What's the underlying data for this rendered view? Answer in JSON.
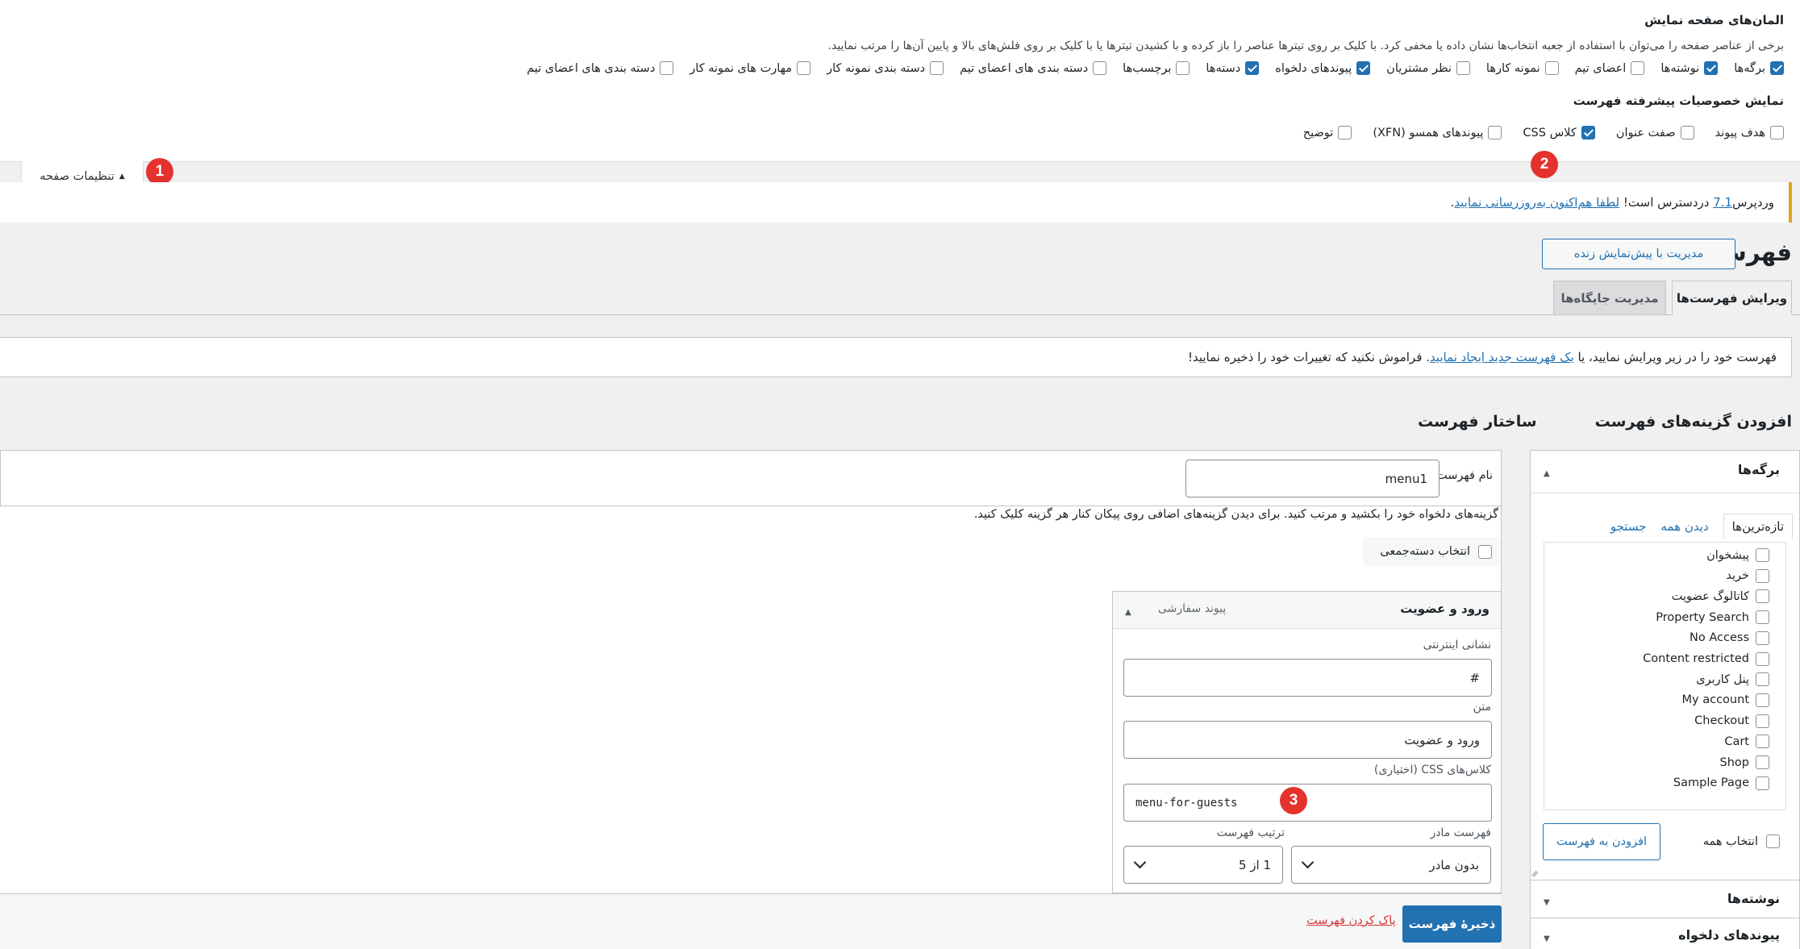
{
  "screen_options": {
    "boxes_heading": "المان‌های صفحه نمایش",
    "boxes_desc": "برخی از عناصر صفحه را می‌توان با استفاده از جعبه انتخاب‌ها نشان داده یا مخفی کرد. با کلیک بر روی تیترها عناصر را باز کرده و با کشیدن تیترها یا با کلیک بر روی فلش‌های بالا و پایین آن‌ها را مرتب نمایید.",
    "boxes": [
      {
        "label": "برگه‌ها",
        "checked": true
      },
      {
        "label": "نوشته‌ها",
        "checked": true
      },
      {
        "label": "اعضای تیم",
        "checked": false
      },
      {
        "label": "نمونه کارها",
        "checked": false
      },
      {
        "label": "نظر مشتریان",
        "checked": false
      },
      {
        "label": "پیوندهای دلخواه",
        "checked": true
      },
      {
        "label": "دسته‌ها",
        "checked": true
      },
      {
        "label": "برچسب‌ها",
        "checked": false
      },
      {
        "label": "دسته بندی های اعضای تیم",
        "checked": false
      },
      {
        "label": "دسته بندی نمونه کار",
        "checked": false
      },
      {
        "label": "مهارت های نمونه کار",
        "checked": false
      },
      {
        "label": "دسته بندی های اعضای تیم",
        "checked": false
      }
    ],
    "advanced_heading": "نمایش خصوصیات پیشرفته فهرست",
    "advanced": [
      {
        "label": "هدف پیوند",
        "checked": false
      },
      {
        "label": "صفت عنوان",
        "checked": false
      },
      {
        "label": "کلاس CSS",
        "checked": true
      },
      {
        "label": "پیوندهای همسو (XFN)",
        "checked": false
      },
      {
        "label": "توضیح",
        "checked": false
      }
    ],
    "tab_label": "تنظیمات صفحه"
  },
  "badges": {
    "one": "1",
    "two": "2",
    "three": "3"
  },
  "notice": {
    "prefix": "وردپرس ",
    "version_link": "7.1",
    "middle": " دردسترس است! ",
    "update_link": "لطفا هم‌اکنون به‌روزرسانی نمایید",
    "suffix": "."
  },
  "header": {
    "title": "فهرست‌ها",
    "live_preview_button": "مدیریت با پیش‌نمایش زنده"
  },
  "nav_tabs": {
    "edit": "ویرایش فهرست‌ها",
    "locations": "مدیریت جایگاه‌ها"
  },
  "manage": {
    "prefix": "فهرست خود را در زیر ویرایش نمایید، یا ",
    "link": "یک فهرست جدید ایجاد نمایید",
    "suffix": ". فراموش نکنید که تغییرات خود را ذخیره نمایید!"
  },
  "add_items": {
    "heading": "افزودن گزینه‌های فهرست",
    "pages_box_title": "برگه‌ها",
    "tabs": {
      "recent": "تازه‌ترین‌ها",
      "view_all": "دیدن همه",
      "search": "جستجو"
    },
    "pages": [
      "پیشخوان",
      "خرید",
      "کاتالوگ عضویت",
      "Property Search",
      "No Access",
      "Content restricted",
      "پنل کاربری",
      "My account",
      "Checkout",
      "Cart",
      "Shop",
      "Sample Page"
    ],
    "select_all": "انتخاب همه",
    "add_button": "افزودن به فهرست",
    "posts_title": "نوشته‌ها",
    "custom_links_title": "پیوندهای دلخواه"
  },
  "structure": {
    "heading": "ساختار فهرست",
    "menu_name_label": "نام فهرست",
    "menu_name_value": "menu1",
    "instructions": "گزینه‌های دلخواه خود را بکشید و مرتب کنید. برای دیدن گزینه‌های اضافی روی پیکان کنار هر گزینه کلیک کنید.",
    "bulk_select": "انتخاب دسته‌جمعی",
    "item": {
      "title": "ورود و عضویت",
      "type": "پیوند سفارشی",
      "url_label": "نشانی اینترنتی",
      "url_value": "#",
      "text_label": "متن",
      "text_value": "ورود و عضویت",
      "css_label": "کلاس‌های CSS (اختیاری)",
      "css_value": "menu-for-guests",
      "parent_label": "فهرست مادر",
      "parent_value": "بدون مادر",
      "order_label": "ترتیب فهرست",
      "order_value": "1 از 5"
    },
    "save_button": "ذخیرهٔ فهرست",
    "delete_link": "پاک کردن فهرست"
  },
  "colors": {
    "accent": "#2271b1",
    "badge": "#e5322d",
    "notice_border": "#dba617",
    "delete": "#d63638"
  }
}
